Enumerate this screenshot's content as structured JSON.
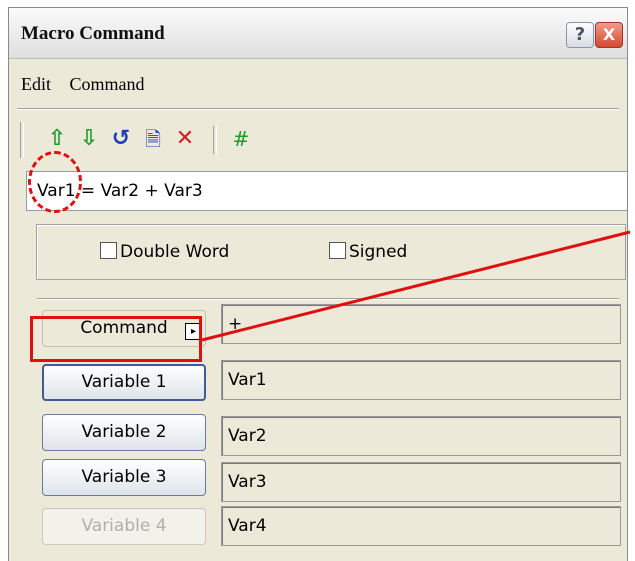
{
  "window": {
    "title": "Macro Command",
    "help_glyph": "?",
    "close_glyph": "X"
  },
  "menu": {
    "items": [
      "Edit",
      "Command"
    ]
  },
  "toolbar": {
    "icons": [
      {
        "name": "move-up-icon",
        "glyph": "⇧"
      },
      {
        "name": "move-down-icon",
        "glyph": "⇩"
      },
      {
        "name": "undo-icon",
        "glyph": "↺"
      },
      {
        "name": "document-icon",
        "glyph": "🗎"
      },
      {
        "name": "delete-icon",
        "glyph": "✕"
      },
      {
        "name": "hash-icon",
        "glyph": "#"
      }
    ]
  },
  "expression": {
    "value": "Var1 = Var2 + Var3"
  },
  "options": {
    "double_word_label": "Double Word",
    "signed_label": "Signed",
    "double_word_checked": false,
    "signed_checked": false
  },
  "command": {
    "button_label": "Command",
    "arrow_glyph": "▸",
    "value": "+"
  },
  "variables": [
    {
      "label": "Variable 1",
      "value": "Var1",
      "enabled": true
    },
    {
      "label": "Variable 2",
      "value": "Var2",
      "enabled": true
    },
    {
      "label": "Variable 3",
      "value": "Var3",
      "enabled": true
    },
    {
      "label": "Variable 4",
      "value": "Var4",
      "enabled": false
    }
  ],
  "annotation_color": "#e01010"
}
